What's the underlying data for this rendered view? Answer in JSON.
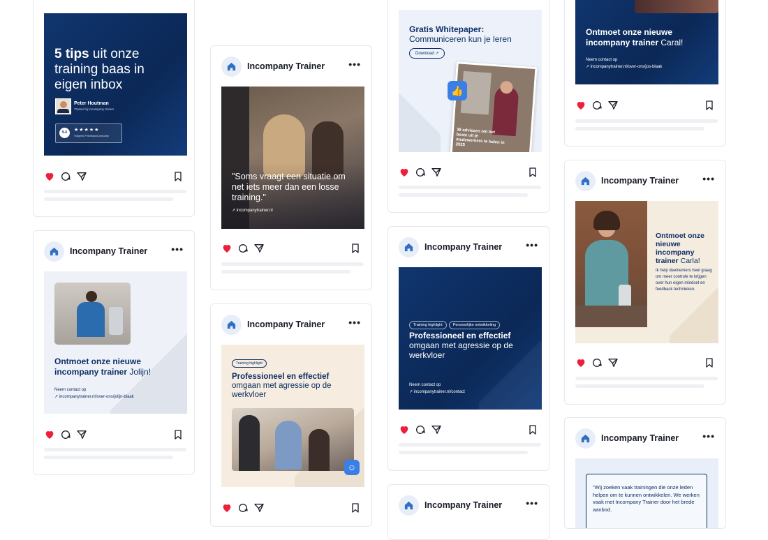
{
  "brand": {
    "name": "Incompany Trainer",
    "more_label": "•••",
    "accent": "#0d2f66",
    "heart_color": "#ee1f3b",
    "icon": "house-logo-icon"
  },
  "post_tips": {
    "title_bold": "5 tips",
    "title_rest": " uit onze training baas in eigen inbox",
    "person_name": "Peter Houtman",
    "person_role": "Trainer bij Incompany trainer",
    "rating": "9.4",
    "stars": "★★★★★",
    "rating_source": "Volgens FeedbackCompany"
  },
  "post_quote": {
    "quote": "\"Soms vraagt een situatie om net iets meer dan een losse training.\"",
    "url": "incompanytrainer.nl"
  },
  "post_whitepaper": {
    "title_bold": "Gratis Whitepaper:",
    "title_rest": "Communiceren kun je leren",
    "download": "Download ↗",
    "book_text": "38 adviezen om het beste uit je medewerkers te halen in 2025"
  },
  "post_carol_top": {
    "title_bold": "Ontmoet onze nieuwe incompany trainer",
    "name": " Caral!",
    "contact_label": "Neem contact op",
    "contact_url": "↗ incompanytrainer.nl/over-ons/jos-blaak"
  },
  "post_jolijn": {
    "title_bold": "Ontmoet onze nieuwe incompany trainer",
    "name": " Jolijn!",
    "contact_label": "Neem contact op",
    "contact_url": "↗ incompanytrainer.nl/over-ons/jolijn-blaak"
  },
  "post_highlight_beige": {
    "tag": "Training highlight",
    "title_bold": "Professioneel en effectief",
    "title_rest": "omgaan met agressie op de werkvloer"
  },
  "post_highlight_navy": {
    "tag1": "Training highlight",
    "tag2": "Persoonlijke ontwikkeling",
    "title_bold": "Professioneel en effectief",
    "title_rest": "omgaan met agressie op de werkvloer",
    "contact_label": "Neem contact op",
    "contact_url": "↗ incompanytrainer.nl/contact"
  },
  "post_carla_right": {
    "title_bold": "Ontmoet onze nieuwe incompany trainer",
    "name": " Carla!",
    "body": "Ik help deelnemers heel graag om meer controle te krijgen over hun eigen mindset en feedback technieken."
  },
  "post_testimonial": {
    "quote": "\"Wij zoeken vaak trainingen die onze leden helpen om te kunnen ontwikkelen. We werken vaak met Incompany Trainer door het brede aanbod."
  }
}
